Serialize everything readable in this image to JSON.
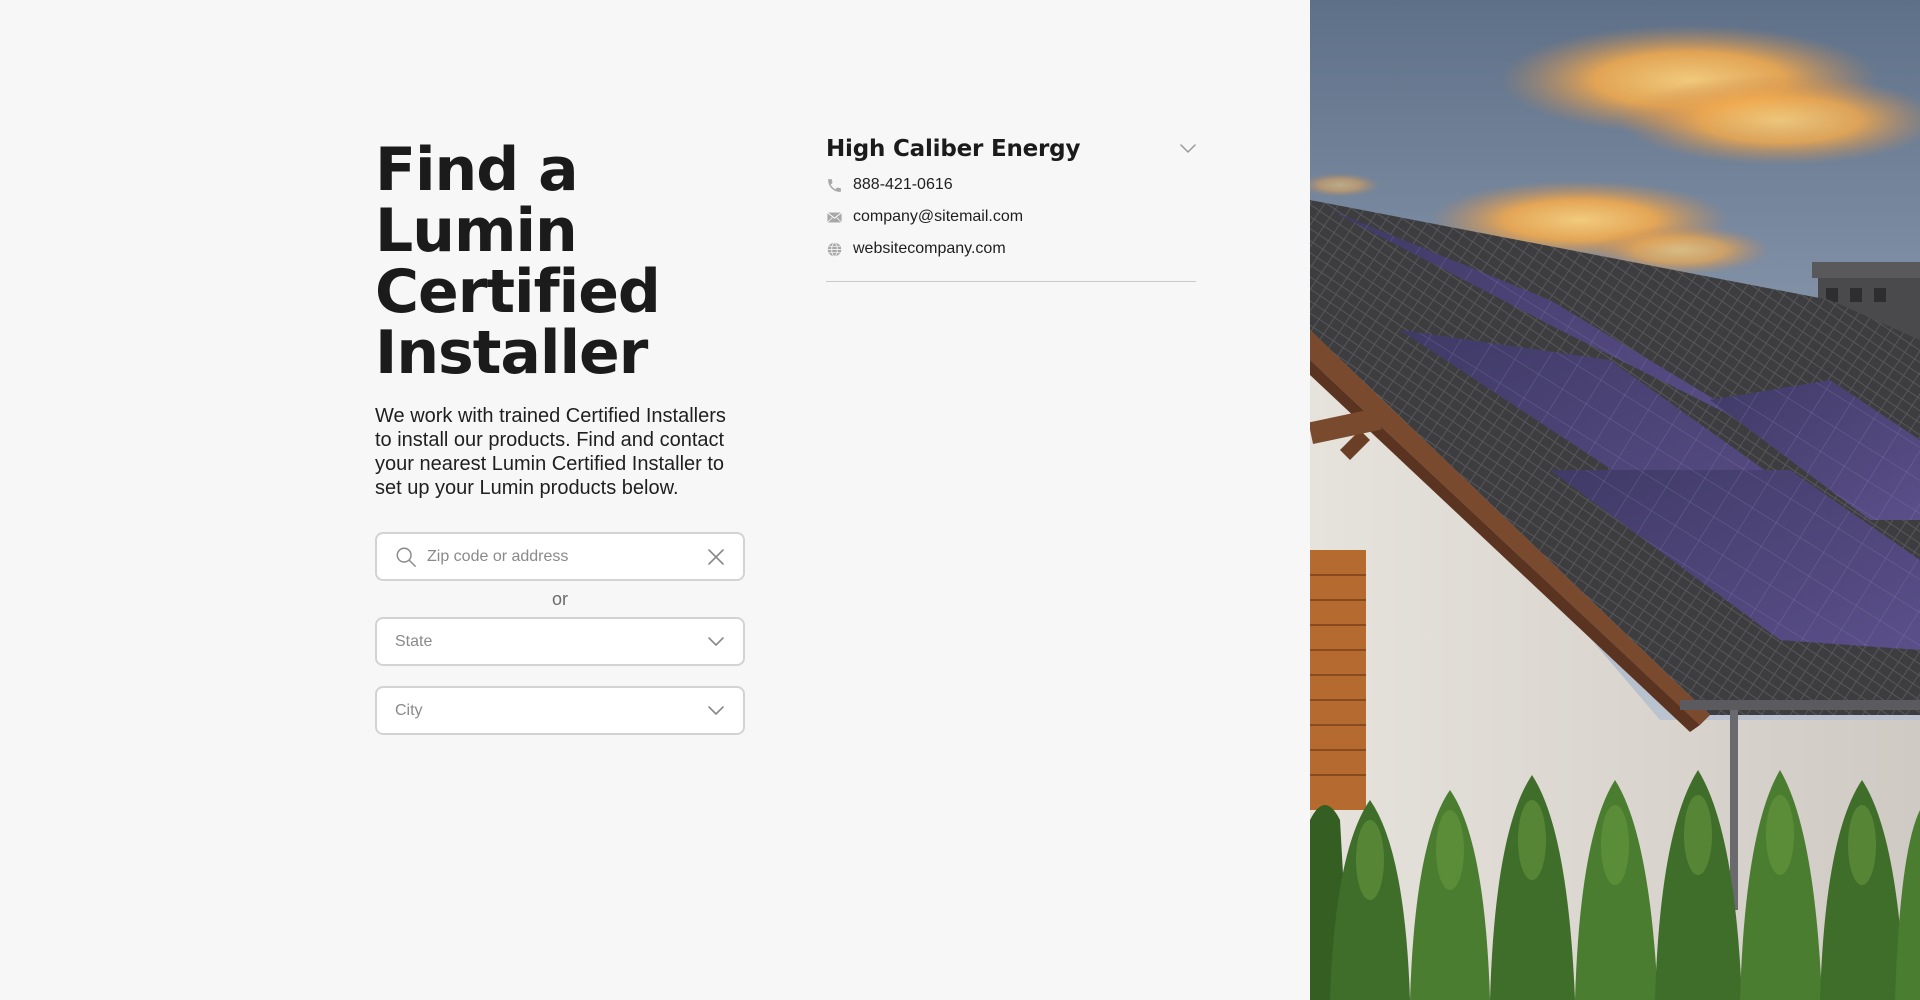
{
  "hero": {
    "title_lines": [
      "Find a Lumin",
      "Certified",
      "Installer"
    ],
    "intro": "We work with trained Certified Installers to install our products. Find and contact your nearest Lumin Certified Installer to set up your Lumin products below."
  },
  "search": {
    "placeholder": "Zip code or address",
    "value": "",
    "search_icon": "search-icon",
    "clear_icon": "close-icon"
  },
  "or_label": "or",
  "state_select": {
    "selected": "State",
    "icon": "chevron-down-icon"
  },
  "city_select": {
    "selected": "City",
    "icon": "chevron-down-icon"
  },
  "installer": {
    "name": "High Caliber Energy",
    "phone": "888-421-0616",
    "email": "company@sitemail.com",
    "website": "websitecompany.com",
    "icons": [
      "phone-icon",
      "mail-icon",
      "globe-icon",
      "chevron-down-icon"
    ]
  },
  "colors": {
    "background": "#f7f7f7",
    "text": "#1b1b1b",
    "border": "#d3d3d3",
    "muted": "#8a8a8a"
  }
}
